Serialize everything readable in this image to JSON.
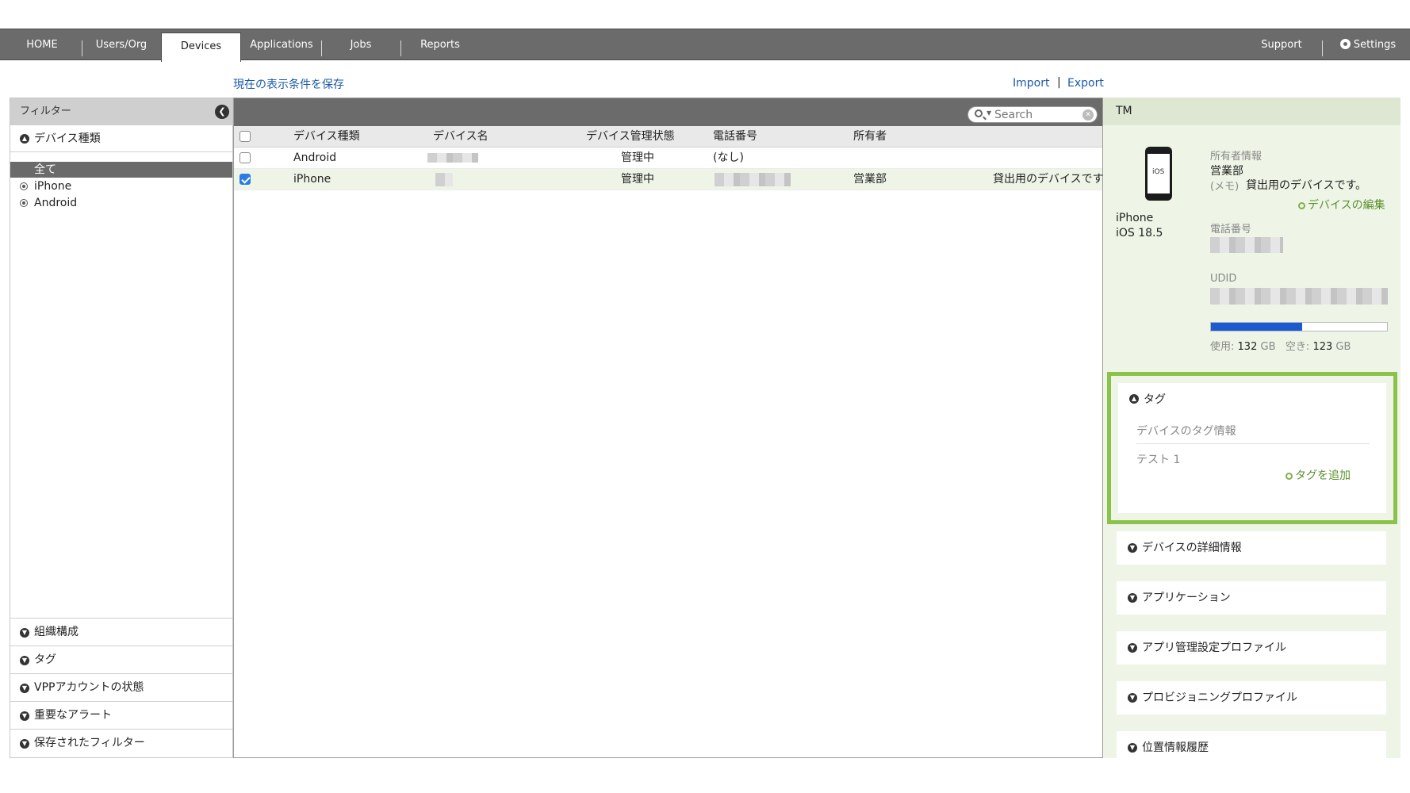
{
  "nav": {
    "home": "HOME",
    "users": "Users/Org",
    "devices": "Devices",
    "applications": "Applications",
    "jobs": "Jobs",
    "reports": "Reports",
    "support": "Support",
    "settings": "Settings"
  },
  "toolbar": {
    "save_view": "現在の表示条件を保存",
    "import": "Import",
    "separator": "|",
    "export": "Export"
  },
  "filter": {
    "title": "フィルター",
    "device_type": "デバイス種類",
    "options": [
      "全て",
      "iPhone",
      "Android"
    ],
    "sections": [
      "組織構成",
      "タグ",
      "VPPアカウントの状態",
      "重要なアラート",
      "保存されたフィルター"
    ]
  },
  "table": {
    "search_placeholder": "Search",
    "columns": [
      "デバイス種類",
      "デバイス名",
      "デバイス管理状態",
      "電話番号",
      "所有者"
    ],
    "rows": [
      {
        "type": "Android",
        "status": "管理中",
        "phone": "(なし)",
        "owner": "",
        "memo": ""
      },
      {
        "type": "iPhone",
        "status": "管理中",
        "phone": "",
        "owner": "営業部",
        "memo": "貸出用のデバイスです"
      }
    ]
  },
  "detail": {
    "header": "TM",
    "phone_screen": "iOS",
    "device_model": "iPhone",
    "os_version": "iOS 18.5",
    "owner_label": "所有者情報",
    "owner_value": "営業部",
    "memo_label": "(メモ)",
    "memo_value": "貸出用のデバイスです。",
    "edit_link": "デバイスの編集",
    "phone_label": "電話番号",
    "udid_label": "UDID",
    "storage_used_label": "使用:",
    "storage_used": "132",
    "storage_unit": "GB",
    "storage_free_label": "空き:",
    "storage_free": "123",
    "storage_fraction": 0.52
  },
  "tags": {
    "title": "タグ",
    "info_label": "デバイスのタグ情報",
    "items": [
      "テスト 1"
    ],
    "add": "タグを追加"
  },
  "sections": [
    "デバイスの詳細情報",
    "アプリケーション",
    "アプリ管理設定プロファイル",
    "プロビジョニングプロファイル",
    "位置情報履歴"
  ]
}
